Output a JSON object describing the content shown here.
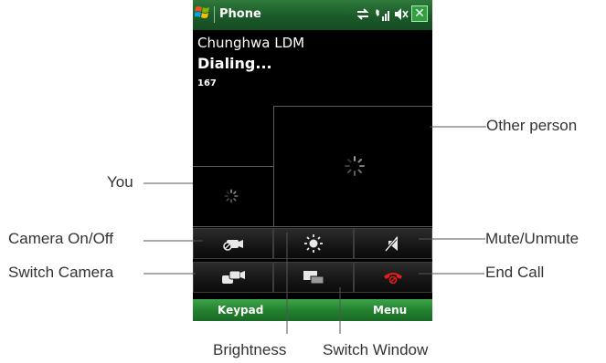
{
  "phone": {
    "app_title": "Phone",
    "caller_name": "Chunghwa LDM",
    "call_status": "Dialing...",
    "number": "167",
    "softkeys": {
      "left": "Keypad",
      "right": "Menu"
    },
    "close_label": "✕",
    "status_icons": [
      "connectivity-icon",
      "signal-icon",
      "volume-muted-icon"
    ]
  },
  "controls": {
    "row1": [
      "camera-toggle-icon",
      "brightness-icon",
      "mute-icon"
    ],
    "row2": [
      "switch-camera-icon",
      "switch-window-icon",
      "end-call-icon"
    ]
  },
  "callouts": {
    "other_person": "Other person",
    "you": "You",
    "camera_onoff": "Camera On/Off",
    "mute_unmute": "Mute/Unmute",
    "switch_camera": "Switch Camera",
    "end_call": "End Call",
    "brightness": "Brightness",
    "switch_window": "Switch Window"
  },
  "colors": {
    "title_bar": "#1b5a28",
    "softkey_bar": "#23822f",
    "end_call": "#e31b1b",
    "screen": "#000000"
  }
}
